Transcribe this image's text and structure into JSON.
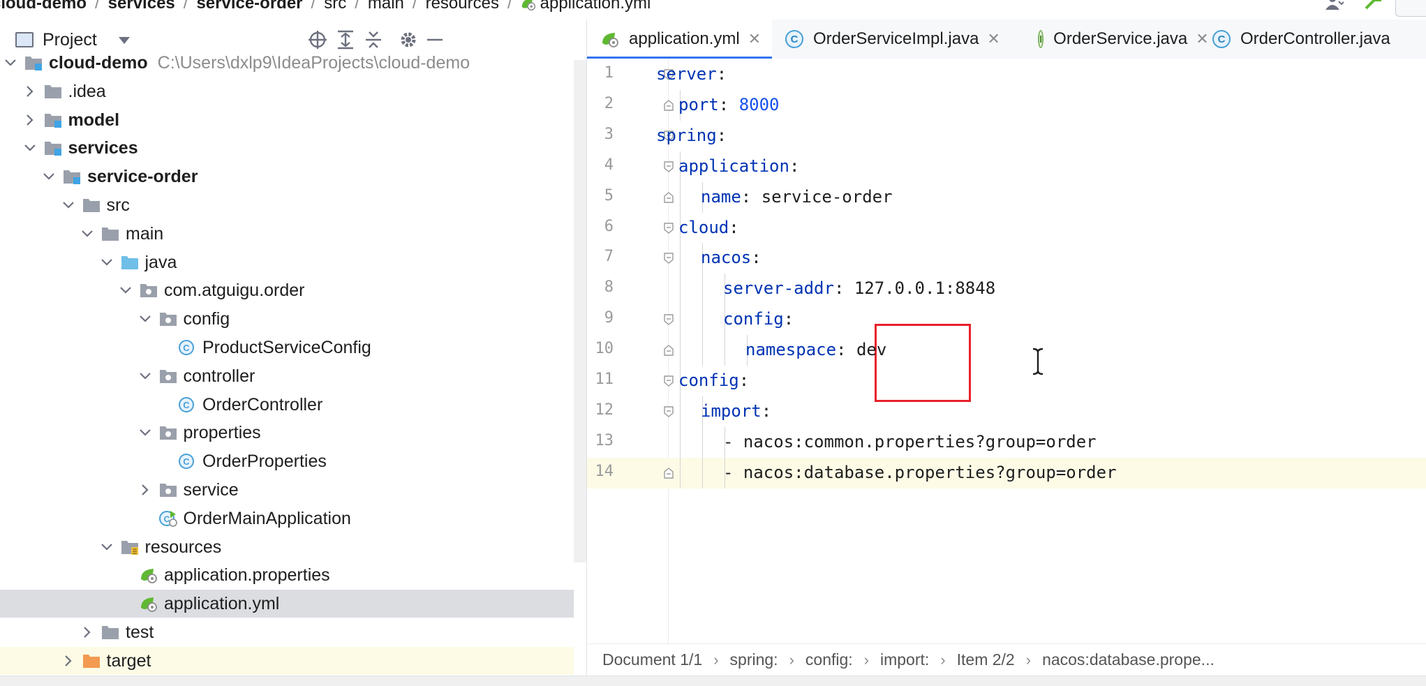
{
  "breadcrumb": {
    "items": [
      {
        "label": "cloud-demo",
        "bold": true
      },
      {
        "label": "services",
        "bold": true
      },
      {
        "label": "service-order",
        "bold": true
      },
      {
        "label": "src",
        "bold": false
      },
      {
        "label": "main",
        "bold": false
      },
      {
        "label": "resources",
        "bold": false
      },
      {
        "label": "application.yml",
        "bold": false
      }
    ]
  },
  "project_panel": {
    "title": "Project",
    "tools": [
      "locate-icon",
      "expand-all-icon",
      "collapse-all-icon",
      "settings-icon",
      "minimize-icon"
    ],
    "tree": [
      {
        "label": "cloud-demo",
        "path": "C:\\Users\\dxlp9\\IdeaProjects\\cloud-demo",
        "depth": 0,
        "expanded": true,
        "icon": "module-folder",
        "bold": true
      },
      {
        "label": ".idea",
        "depth": 1,
        "expanded": false,
        "icon": "folder"
      },
      {
        "label": "model",
        "depth": 1,
        "expanded": false,
        "icon": "module-folder",
        "bold": true
      },
      {
        "label": "services",
        "depth": 1,
        "expanded": true,
        "icon": "module-folder",
        "bold": true
      },
      {
        "label": "service-order",
        "depth": 2,
        "expanded": true,
        "icon": "module-folder",
        "bold": true
      },
      {
        "label": "src",
        "depth": 3,
        "expanded": true,
        "icon": "folder"
      },
      {
        "label": "main",
        "depth": 4,
        "expanded": true,
        "icon": "folder"
      },
      {
        "label": "java",
        "depth": 5,
        "expanded": true,
        "icon": "source-folder"
      },
      {
        "label": "com.atguigu.order",
        "depth": 6,
        "expanded": true,
        "icon": "package"
      },
      {
        "label": "config",
        "depth": 7,
        "expanded": true,
        "icon": "package"
      },
      {
        "label": "ProductServiceConfig",
        "depth": 8,
        "icon": "class"
      },
      {
        "label": "controller",
        "depth": 7,
        "expanded": true,
        "icon": "package"
      },
      {
        "label": "OrderController",
        "depth": 8,
        "icon": "class"
      },
      {
        "label": "properties",
        "depth": 7,
        "expanded": true,
        "icon": "package"
      },
      {
        "label": "OrderProperties",
        "depth": 8,
        "icon": "class"
      },
      {
        "label": "service",
        "depth": 7,
        "expanded": false,
        "icon": "package"
      },
      {
        "label": "OrderMainApplication",
        "depth": 7,
        "icon": "spring-app"
      },
      {
        "label": "resources",
        "depth": 5,
        "expanded": true,
        "icon": "resources-folder"
      },
      {
        "label": "application.properties",
        "depth": 6,
        "icon": "spring-config"
      },
      {
        "label": "application.yml",
        "depth": 6,
        "icon": "spring-config",
        "selected": true
      },
      {
        "label": "test",
        "depth": 4,
        "expanded": false,
        "icon": "folder"
      },
      {
        "label": "target",
        "depth": 3,
        "expanded": false,
        "icon": "excluded-folder",
        "highlight": true
      }
    ]
  },
  "tabs": [
    {
      "label": "application.yml",
      "icon": "spring-config",
      "active": true,
      "closable": true
    },
    {
      "label": "OrderServiceImpl.java",
      "icon": "class",
      "closable": true
    },
    {
      "label": "OrderService.java",
      "icon": "interface",
      "closable": true
    },
    {
      "label": "OrderController.java",
      "icon": "class",
      "closable": false
    }
  ],
  "editor": {
    "lines": [
      {
        "n": "1",
        "indent": 0,
        "key": "server",
        "sep": ":",
        "value": "",
        "vtype": "val"
      },
      {
        "n": "2",
        "indent": 1,
        "key": "port",
        "sep": ": ",
        "value": "8000",
        "vtype": "num"
      },
      {
        "n": "3",
        "indent": 0,
        "key": "spring",
        "sep": ":",
        "value": "",
        "vtype": "val"
      },
      {
        "n": "4",
        "indent": 1,
        "key": "application",
        "sep": ":",
        "value": "",
        "vtype": "val"
      },
      {
        "n": "5",
        "indent": 2,
        "key": "name",
        "sep": ": ",
        "value": "service-order",
        "vtype": "val"
      },
      {
        "n": "6",
        "indent": 1,
        "key": "cloud",
        "sep": ":",
        "value": "",
        "vtype": "val"
      },
      {
        "n": "7",
        "indent": 2,
        "key": "nacos",
        "sep": ":",
        "value": "",
        "vtype": "val"
      },
      {
        "n": "8",
        "indent": 3,
        "key": "server-addr",
        "sep": ": ",
        "value": "127.0.0.1:8848",
        "vtype": "val"
      },
      {
        "n": "9",
        "indent": 3,
        "key": "config",
        "sep": ":",
        "value": "",
        "vtype": "val"
      },
      {
        "n": "10",
        "indent": 4,
        "key": "namespace",
        "sep": ": ",
        "value": "dev",
        "vtype": "val"
      },
      {
        "n": "11",
        "indent": 1,
        "key": "config",
        "sep": ":",
        "value": "",
        "vtype": "val"
      },
      {
        "n": "12",
        "indent": 2,
        "key": "import",
        "sep": ":",
        "value": "",
        "vtype": "val"
      },
      {
        "n": "13",
        "indent": 3,
        "key": "",
        "sep": "- ",
        "value": "nacos:common.properties?group=order",
        "vtype": "val"
      },
      {
        "n": "14",
        "indent": 3,
        "key": "",
        "sep": "- ",
        "value": "nacos:database.properties?group=order",
        "vtype": "val",
        "current": true
      }
    ]
  },
  "statusbar": {
    "items": [
      "Document 1/1",
      "spring:",
      "config:",
      "import:",
      "Item 2/2",
      "nacos:database.prope..."
    ]
  },
  "colors": {
    "key": "#0033b3",
    "number": "#1750eb",
    "selection": "#dcdde1",
    "annotation_box": "#e8202a",
    "active_tab_underline": "#3574f0"
  }
}
